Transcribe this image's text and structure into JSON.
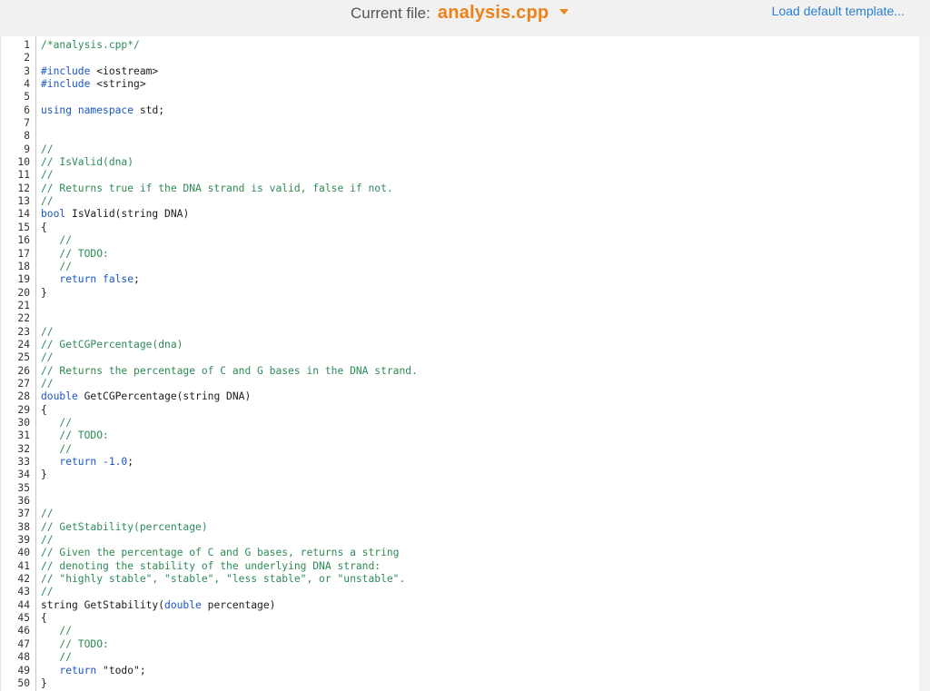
{
  "header": {
    "current_file_label": "Current file:",
    "file_name": "analysis.cpp",
    "load_template_label": "Load default template..."
  },
  "editor": {
    "lines": [
      {
        "n": "1",
        "tokens": [
          {
            "t": "/*analysis.cpp*/",
            "c": "comment"
          }
        ]
      },
      {
        "n": "2",
        "tokens": []
      },
      {
        "n": "3",
        "tokens": [
          {
            "t": "#include ",
            "c": "pre"
          },
          {
            "t": "<iostream>",
            "c": "plain"
          }
        ]
      },
      {
        "n": "4",
        "tokens": [
          {
            "t": "#include ",
            "c": "pre"
          },
          {
            "t": "<string>",
            "c": "plain"
          }
        ]
      },
      {
        "n": "5",
        "tokens": []
      },
      {
        "n": "6",
        "tokens": [
          {
            "t": "using",
            "c": "keyword"
          },
          {
            "t": " ",
            "c": "plain"
          },
          {
            "t": "namespace",
            "c": "keyword"
          },
          {
            "t": " std;",
            "c": "plain"
          }
        ]
      },
      {
        "n": "7",
        "tokens": []
      },
      {
        "n": "8",
        "tokens": []
      },
      {
        "n": "9",
        "tokens": [
          {
            "t": "//",
            "c": "comment"
          }
        ]
      },
      {
        "n": "10",
        "tokens": [
          {
            "t": "// IsValid(dna)",
            "c": "comment"
          }
        ]
      },
      {
        "n": "11",
        "tokens": [
          {
            "t": "//",
            "c": "comment"
          }
        ]
      },
      {
        "n": "12",
        "tokens": [
          {
            "t": "// Returns true if the DNA strand is valid, false if not.",
            "c": "comment"
          }
        ]
      },
      {
        "n": "13",
        "tokens": [
          {
            "t": "//",
            "c": "comment"
          }
        ]
      },
      {
        "n": "14",
        "tokens": [
          {
            "t": "bool",
            "c": "keyword"
          },
          {
            "t": " IsValid(string DNA)",
            "c": "plain"
          }
        ]
      },
      {
        "n": "15",
        "tokens": [
          {
            "t": "{",
            "c": "plain"
          }
        ]
      },
      {
        "n": "16",
        "tokens": [
          {
            "t": "   //",
            "c": "comment"
          }
        ]
      },
      {
        "n": "17",
        "tokens": [
          {
            "t": "   // TODO:",
            "c": "comment"
          }
        ]
      },
      {
        "n": "18",
        "tokens": [
          {
            "t": "   //",
            "c": "comment"
          }
        ]
      },
      {
        "n": "19",
        "tokens": [
          {
            "t": "   ",
            "c": "plain"
          },
          {
            "t": "return",
            "c": "keyword"
          },
          {
            "t": " ",
            "c": "plain"
          },
          {
            "t": "false",
            "c": "keyword"
          },
          {
            "t": ";",
            "c": "plain"
          }
        ]
      },
      {
        "n": "20",
        "tokens": [
          {
            "t": "}",
            "c": "plain"
          }
        ]
      },
      {
        "n": "21",
        "tokens": []
      },
      {
        "n": "22",
        "tokens": []
      },
      {
        "n": "23",
        "tokens": [
          {
            "t": "//",
            "c": "comment"
          }
        ]
      },
      {
        "n": "24",
        "tokens": [
          {
            "t": "// GetCGPercentage(dna)",
            "c": "comment"
          }
        ]
      },
      {
        "n": "25",
        "tokens": [
          {
            "t": "//",
            "c": "comment"
          }
        ]
      },
      {
        "n": "26",
        "tokens": [
          {
            "t": "// Returns the percentage of C and G bases in the DNA strand.",
            "c": "comment"
          }
        ]
      },
      {
        "n": "27",
        "tokens": [
          {
            "t": "//",
            "c": "comment"
          }
        ]
      },
      {
        "n": "28",
        "tokens": [
          {
            "t": "double",
            "c": "keyword"
          },
          {
            "t": " GetCGPercentage(string DNA)",
            "c": "plain"
          }
        ]
      },
      {
        "n": "29",
        "tokens": [
          {
            "t": "{",
            "c": "plain"
          }
        ]
      },
      {
        "n": "30",
        "tokens": [
          {
            "t": "   //",
            "c": "comment"
          }
        ]
      },
      {
        "n": "31",
        "tokens": [
          {
            "t": "   // TODO:",
            "c": "comment"
          }
        ]
      },
      {
        "n": "32",
        "tokens": [
          {
            "t": "   //",
            "c": "comment"
          }
        ]
      },
      {
        "n": "33",
        "tokens": [
          {
            "t": "   ",
            "c": "plain"
          },
          {
            "t": "return",
            "c": "keyword"
          },
          {
            "t": " ",
            "c": "plain"
          },
          {
            "t": "-1.0",
            "c": "number"
          },
          {
            "t": ";",
            "c": "plain"
          }
        ]
      },
      {
        "n": "34",
        "tokens": [
          {
            "t": "}",
            "c": "plain"
          }
        ]
      },
      {
        "n": "35",
        "tokens": []
      },
      {
        "n": "36",
        "tokens": []
      },
      {
        "n": "37",
        "tokens": [
          {
            "t": "//",
            "c": "comment"
          }
        ]
      },
      {
        "n": "38",
        "tokens": [
          {
            "t": "// GetStability(percentage)",
            "c": "comment"
          }
        ]
      },
      {
        "n": "39",
        "tokens": [
          {
            "t": "//",
            "c": "comment"
          }
        ]
      },
      {
        "n": "40",
        "tokens": [
          {
            "t": "// Given the percentage of C and G bases, returns a string",
            "c": "comment"
          }
        ]
      },
      {
        "n": "41",
        "tokens": [
          {
            "t": "// denoting the stability of the underlying DNA strand:",
            "c": "comment"
          }
        ]
      },
      {
        "n": "42",
        "tokens": [
          {
            "t": "// \"highly stable\", \"stable\", \"less stable\", or \"unstable\".",
            "c": "comment"
          }
        ]
      },
      {
        "n": "43",
        "tokens": [
          {
            "t": "//",
            "c": "comment"
          }
        ]
      },
      {
        "n": "44",
        "tokens": [
          {
            "t": "string GetStability(",
            "c": "plain"
          },
          {
            "t": "double",
            "c": "keyword"
          },
          {
            "t": " percentage)",
            "c": "plain"
          }
        ]
      },
      {
        "n": "45",
        "tokens": [
          {
            "t": "{",
            "c": "plain"
          }
        ]
      },
      {
        "n": "46",
        "tokens": [
          {
            "t": "   //",
            "c": "comment"
          }
        ]
      },
      {
        "n": "47",
        "tokens": [
          {
            "t": "   // TODO:",
            "c": "comment"
          }
        ]
      },
      {
        "n": "48",
        "tokens": [
          {
            "t": "   //",
            "c": "comment"
          }
        ]
      },
      {
        "n": "49",
        "tokens": [
          {
            "t": "   ",
            "c": "plain"
          },
          {
            "t": "return",
            "c": "keyword"
          },
          {
            "t": " ",
            "c": "plain"
          },
          {
            "t": "\"todo\"",
            "c": "string"
          },
          {
            "t": ";",
            "c": "plain"
          }
        ]
      },
      {
        "n": "50",
        "tokens": [
          {
            "t": "}",
            "c": "plain"
          }
        ]
      }
    ]
  },
  "colors": {
    "accent_orange": "#f08018",
    "link_blue": "#2a7fd4",
    "keyword_blue": "#1a56c4",
    "comment_green": "#2e8b57"
  }
}
